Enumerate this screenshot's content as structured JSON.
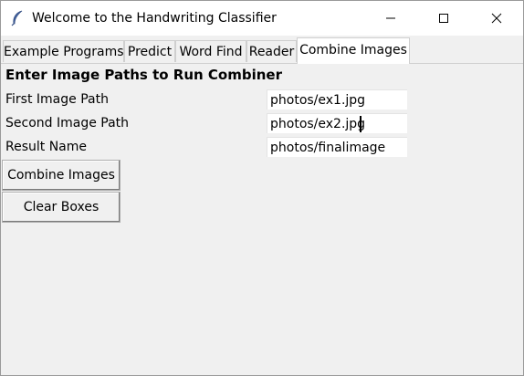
{
  "window": {
    "title": "Welcome to the Handwriting Classifier",
    "app_icon": "feather-icon",
    "controls": [
      "minimize-icon",
      "maximize-icon",
      "close-icon"
    ]
  },
  "tabs": [
    {
      "label": "Example Programs",
      "active": false
    },
    {
      "label": "Predict",
      "active": false
    },
    {
      "label": "Word Find",
      "active": false
    },
    {
      "label": "Reader",
      "active": false
    },
    {
      "label": "Combine Images",
      "active": true
    }
  ],
  "form": {
    "heading": "Enter Image Paths to Run Combiner",
    "fields": [
      {
        "label": "First Image Path",
        "value": "photos/ex1.jpg"
      },
      {
        "label": "Second Image Path",
        "value": "photos/ex2.jpg"
      },
      {
        "label": "Result Name",
        "value": "photos/finalimage"
      }
    ]
  },
  "buttons": {
    "combine": "Combine Images",
    "clear": "Clear Boxes"
  }
}
